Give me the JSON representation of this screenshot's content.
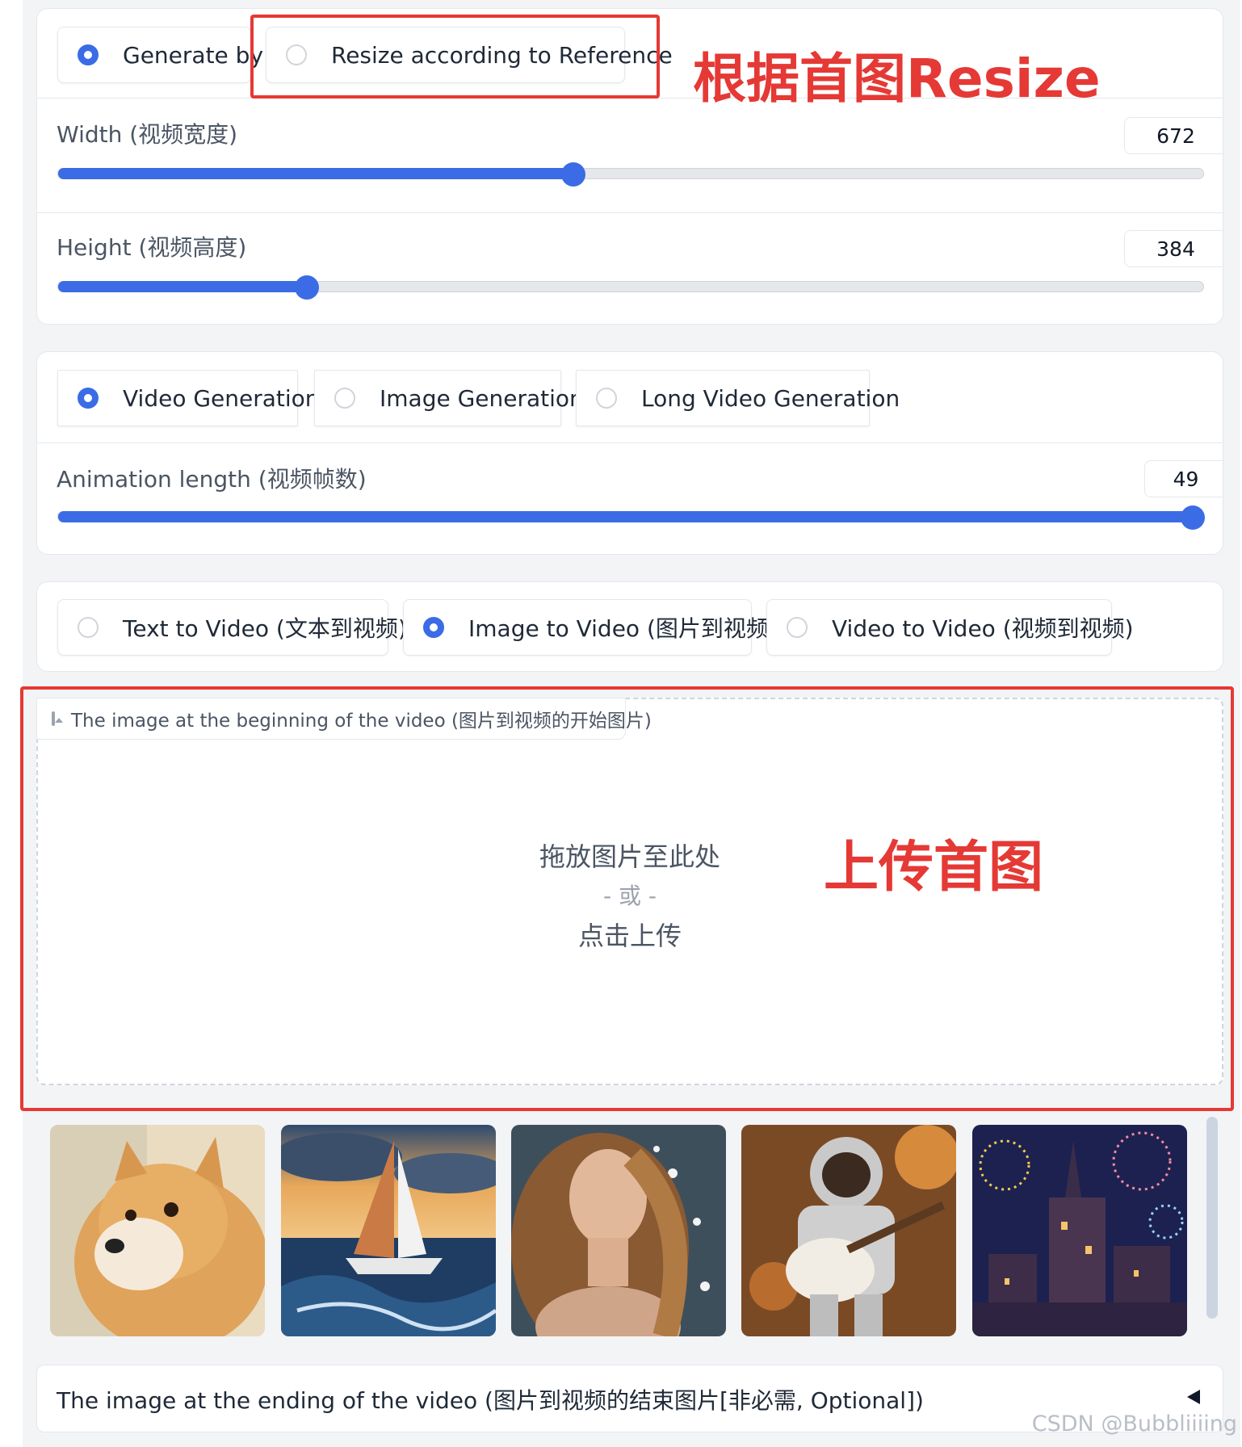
{
  "size_mode": {
    "options": [
      "Generate by",
      "Resize according to Reference"
    ],
    "selected": "Generate by",
    "annotation": "根据首图Resize"
  },
  "width": {
    "label": "Width (视频宽度)",
    "value": "672",
    "fraction": 0.45
  },
  "height": {
    "label": "Height (视频高度)",
    "value": "384",
    "fraction": 0.217
  },
  "generation_type": {
    "options": [
      "Video Generation",
      "Image Generation",
      "Long Video Generation"
    ],
    "selected": "Video Generation"
  },
  "animation_length": {
    "label": "Animation length (视频帧数)",
    "value": "49",
    "fraction": 1.0
  },
  "mode": {
    "options": [
      "Text to Video (文本到视频)",
      "Image to Video (图片到视频)",
      "Video to Video (视频到视频)"
    ],
    "selected": "Image to Video (图片到视频)"
  },
  "start_image": {
    "label": "The image at the beginning of the video (图片到视频的开始图片)",
    "drop_line1": "拖放图片至此处",
    "drop_or": "- 或 -",
    "drop_line2": "点击上传",
    "annotation": "上传首图"
  },
  "examples": [
    {
      "icon": "shiba-dog-photo"
    },
    {
      "icon": "sailboat-ocean-photo"
    },
    {
      "icon": "woman-portrait-photo"
    },
    {
      "icon": "astronaut-guitar-photo"
    },
    {
      "icon": "castle-fireworks-photo"
    }
  ],
  "end_image": {
    "label": "The image at the ending of the video (图片到视频的结束图片[非必需, Optional])"
  },
  "watermark": "CSDN @Bubbliiiing",
  "colors": {
    "accent": "#3b6ce6",
    "annotation_red": "#e53935"
  }
}
